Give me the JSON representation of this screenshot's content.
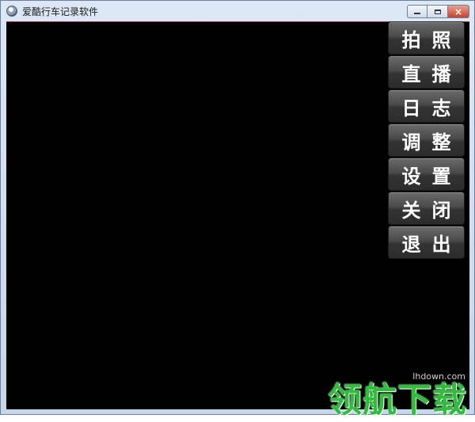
{
  "window": {
    "title": "爱酷行车记录软件",
    "controls": {
      "minimize": "",
      "maximize": "",
      "close": "×"
    }
  },
  "menu": {
    "items": [
      {
        "id": "photo",
        "label": "拍照"
      },
      {
        "id": "live",
        "label": "直播"
      },
      {
        "id": "log",
        "label": "日志"
      },
      {
        "id": "adjust",
        "label": "调整"
      },
      {
        "id": "settings",
        "label": "设置"
      },
      {
        "id": "close",
        "label": "关闭"
      },
      {
        "id": "exit",
        "label": "退出"
      }
    ]
  },
  "watermark": {
    "url": "lhdown.com",
    "text": "领航下载"
  },
  "colors": {
    "viewport": "#000000",
    "button_text": "#ffffff",
    "watermark": "#2dbf3a",
    "close_button": "#c7432c"
  }
}
